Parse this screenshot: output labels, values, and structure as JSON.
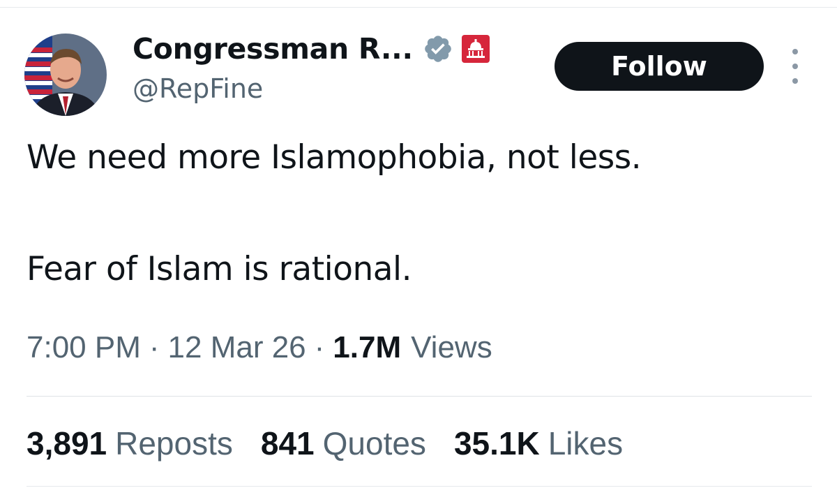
{
  "author": {
    "display_name": "Congressman R...",
    "handle": "@RepFine",
    "verified_icon": "verified-checkmark-icon",
    "affiliation_icon": "us-capitol-badge-icon",
    "colors": {
      "verified": "#829aab",
      "gov_badge": "#d6263b"
    }
  },
  "actions": {
    "follow_label": "Follow",
    "more_icon": "more-options-icon"
  },
  "tweet": {
    "lines": [
      "We need more Islamophobia, not less.",
      "Fear of Islam is rational."
    ]
  },
  "meta": {
    "time": "7:00 PM",
    "separator": "·",
    "date": "12 Mar 26",
    "views_count": "1.7M",
    "views_label": "Views"
  },
  "stats": [
    {
      "count": "3,891",
      "label": "Reposts"
    },
    {
      "count": "841",
      "label": "Quotes"
    },
    {
      "count": "35.1K",
      "label": "Likes"
    }
  ]
}
